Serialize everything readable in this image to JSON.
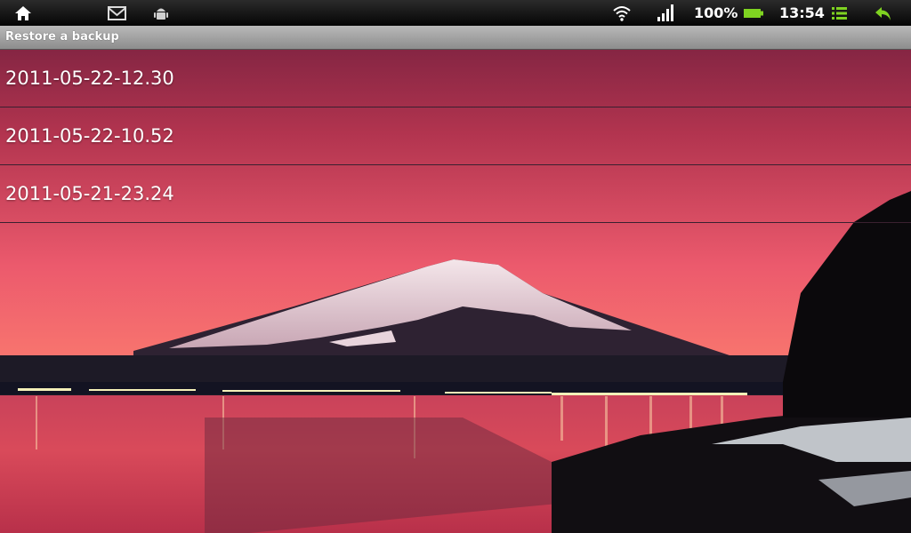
{
  "status_bar": {
    "left_icons": [
      "home-icon",
      "gmail-icon",
      "android-debug-icon"
    ],
    "battery_percent": "100%",
    "time": "13:54",
    "right_icons": [
      "wifi-icon",
      "signal-icon",
      "battery-icon",
      "menu-icon",
      "back-icon"
    ],
    "accent_color": "#7fd321"
  },
  "title": "Restore a backup",
  "backups": [
    {
      "label": "2011-05-22-12.30"
    },
    {
      "label": "2011-05-22-10.52"
    },
    {
      "label": "2011-05-21-23.24"
    }
  ],
  "wallpaper": {
    "subject": "mountain-lake-sunset",
    "sky_color": "#e04a6e"
  }
}
